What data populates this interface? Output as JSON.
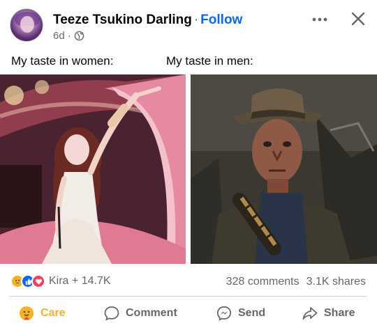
{
  "post": {
    "author": "Teeze Tsukino Darling",
    "separator": "·",
    "follow_label": "Follow",
    "time": "6d",
    "meta_separator": "·",
    "audience_icon": "globe-icon",
    "caption_left": "My taste in women:",
    "caption_right": "My taste in men:"
  },
  "stats": {
    "reaction_icons": [
      "care-react-icon",
      "like-react-icon",
      "love-react-icon"
    ],
    "reactions_text": "Kira + 14.7K",
    "comments": "328 comments",
    "shares": "3.1K shares"
  },
  "actions": {
    "care": "Care",
    "comment": "Comment",
    "send": "Send",
    "share": "Share"
  },
  "colors": {
    "accent": "#0866ff",
    "secondary_text": "#65676b",
    "care": "#f7b125",
    "love": "#f33e58",
    "divider": "#ced0d4"
  }
}
